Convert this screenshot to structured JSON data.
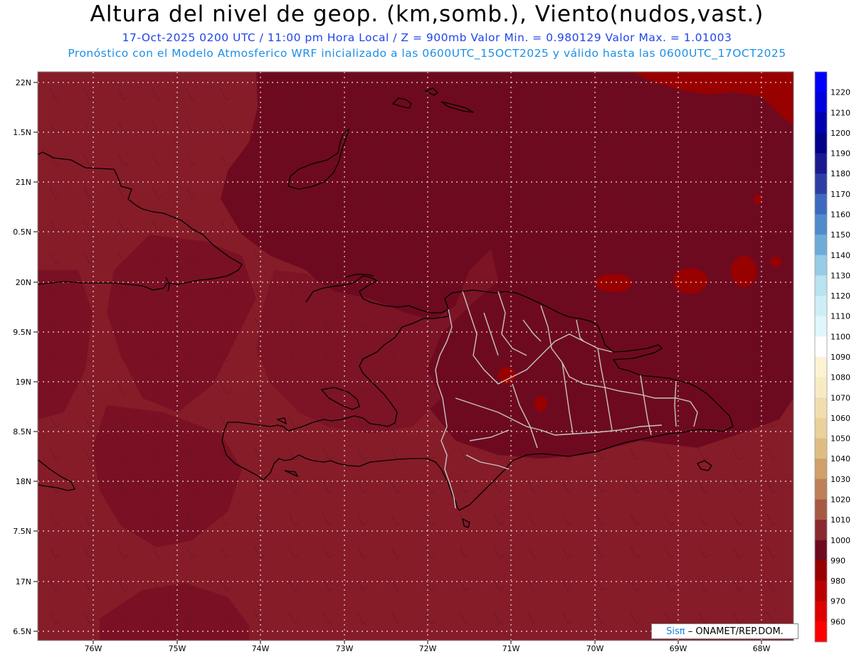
{
  "header": {
    "title": "Altura del nivel de geop. (km,somb.), Viento(nudos,vast.)",
    "line1": "17-Oct-2025  0200 UTC / 11:00 pm Hora Local / Z = 900mb   Valor Min. = 0.980129  Valor Max. = 1.01003",
    "line2": "Pronóstico con el Modelo Atmosferico WRF inicializado a las 0600UTC_15OCT2025 y válido hasta las  0600UTC_17OCT2025"
  },
  "axes": {
    "lat_labels": [
      "22N",
      "1.5N",
      "21N",
      "0.5N",
      "20N",
      "9.5N",
      "19N",
      "8.5N",
      "18N",
      "7.5N",
      "17N",
      "6.5N"
    ],
    "lon_labels": [
      "76W",
      "75W",
      "74W",
      "73W",
      "72W",
      "71W",
      "70W",
      "69W",
      "68W"
    ]
  },
  "colorbar": {
    "labels": [
      "1220",
      "1210",
      "1200",
      "1190",
      "1180",
      "1170",
      "1160",
      "1150",
      "1140",
      "1130",
      "1120",
      "1110",
      "1100",
      "1090",
      "1080",
      "1070",
      "1060",
      "1050",
      "1040",
      "1030",
      "1020",
      "1010",
      "1000",
      "990",
      "980",
      "970",
      "960"
    ],
    "colors": [
      "#0000ff",
      "#0000dd",
      "#0000b0",
      "#00008a",
      "#1a1a90",
      "#2d3fa5",
      "#3d6abf",
      "#4f8ccc",
      "#6fabd9",
      "#97cbe6",
      "#b8e3ef",
      "#cdeef6",
      "#dff6fb",
      "#ffffff",
      "#fbf3d2",
      "#f7ebc4",
      "#f1deb0",
      "#ead09a",
      "#dfbd82",
      "#cfa06a",
      "#bd8058",
      "#a65a44",
      "#8a2a30",
      "#6e0a1f",
      "#990000",
      "#bb0000",
      "#dd0000",
      "#ff0000"
    ]
  },
  "credit": {
    "brand": "Sisπ",
    "text": "– ONAMET/REP.DOM."
  },
  "colors": {
    "field_main": "#861c28",
    "field_dark": "#6e0a20",
    "field_mid": "#7c1426",
    "field_high": "#990000",
    "coastline": "#000000",
    "provinces": "#c8c8c8"
  }
}
